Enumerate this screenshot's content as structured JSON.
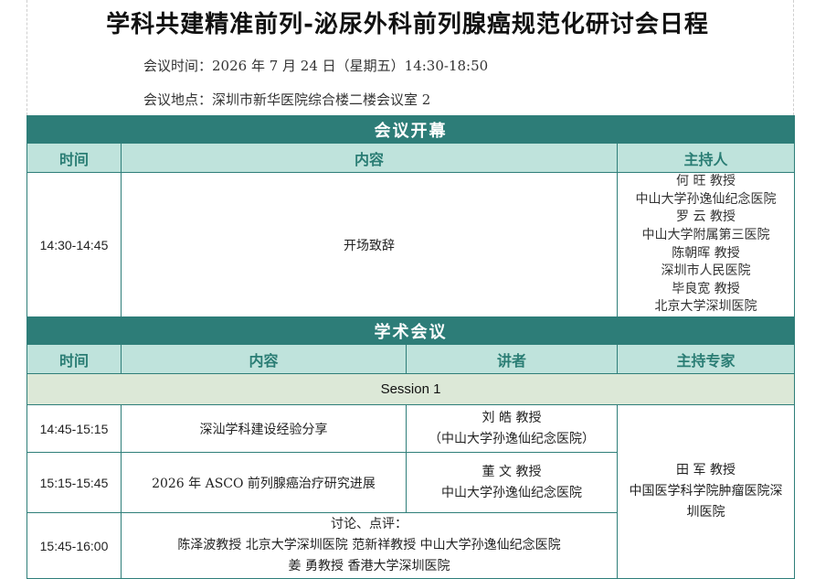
{
  "title": "学科共建精准前列-泌尿外科前列腺癌规范化研讨会日程",
  "meeting": {
    "time": "会议时间：2026 年 7 月 24 日（星期五）14:30-18:50",
    "location": "会议地点：深圳市新华医院综合楼二楼会议室 2"
  },
  "opening": {
    "section_title": "会议开幕",
    "headers": {
      "time": "时间",
      "content": "内容",
      "host": "主持人"
    },
    "row": {
      "time": "14:30-14:45",
      "content": "开场致辞",
      "hosts": [
        "何  旺  教授",
        "中山大学孙逸仙纪念医院",
        "罗  云   教授",
        "中山大学附属第三医院",
        "陈朝晖  教授",
        "深圳市人民医院",
        "毕良宽  教授",
        "北京大学深圳医院"
      ]
    }
  },
  "academic": {
    "section_title": "学术会议",
    "headers": {
      "time": "时间",
      "content": "内容",
      "speaker": "讲者",
      "host": "主持专家"
    },
    "session_label": "Session 1",
    "rows": [
      {
        "time": "14:45-15:15",
        "content": "深汕学科建设经验分享",
        "speaker_name": "刘  皓  教授",
        "speaker_org": "（中山大学孙逸仙纪念医院）"
      },
      {
        "time": "15:15-15:45",
        "content": "2026 年 ASCO 前列腺癌治疗研究进展",
        "speaker_name": "董  文  教授",
        "speaker_org": "中山大学孙逸仙纪念医院"
      },
      {
        "time": "15:45-16:00",
        "discussion": [
          "讨论、点评：",
          "陈泽波教授  北京大学深圳医院    范新祥教授  中山大学孙逸仙纪念医院",
          "姜  勇教授  香港大学深圳医院"
        ]
      }
    ],
    "chair": {
      "name": "田  军  教授",
      "org_line1": "中国医学科学院肿瘤医院深",
      "org_line2": "圳医院"
    }
  }
}
